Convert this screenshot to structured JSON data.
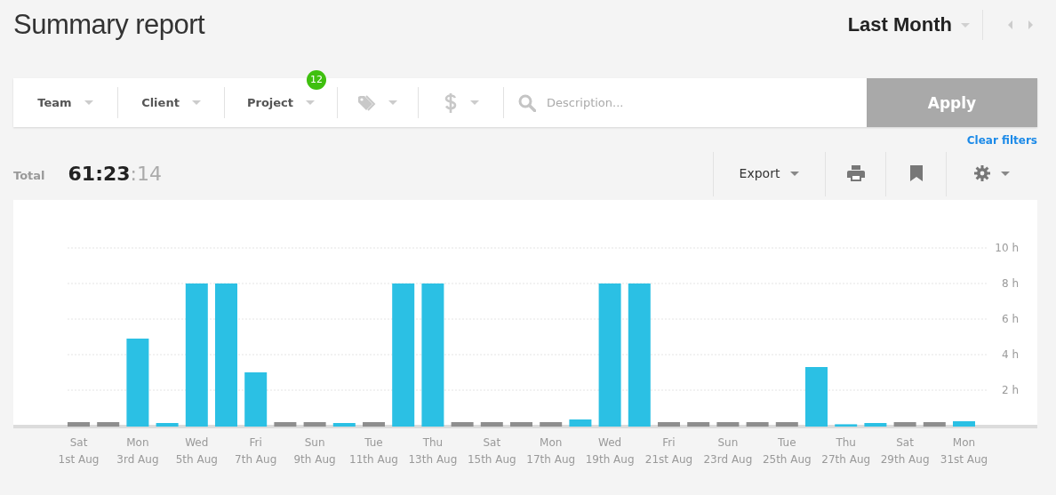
{
  "title": "Summary report",
  "period": {
    "label": "Last Month"
  },
  "filters": [
    {
      "kind": "text",
      "label": "Team"
    },
    {
      "kind": "text",
      "label": "Client"
    },
    {
      "kind": "text",
      "label": "Project",
      "badge": "12"
    },
    {
      "kind": "tag"
    },
    {
      "kind": "billable"
    }
  ],
  "search": {
    "placeholder": "Description..."
  },
  "apply_button": {
    "label": "Apply",
    "disabled": true
  },
  "clear_filters": "Clear filters",
  "total": {
    "label": "Total",
    "main": "61:23",
    "seconds": ":14"
  },
  "toolbar": {
    "export": "Export"
  },
  "chart": {
    "chart_data": {
      "type": "bar",
      "categories": [
        "Sat\n1st Aug",
        null,
        "Mon\n3rd Aug",
        null,
        "Wed\n5th Aug",
        null,
        "Fri\n7th Aug",
        null,
        "Sun\n9th Aug",
        null,
        "Tue\n11th Aug",
        null,
        "Thu\n13th Aug",
        null,
        "Sat\n15th Aug",
        null,
        "Mon\n17th Aug",
        null,
        "Wed\n19th Aug",
        null,
        "Fri\n21st Aug",
        null,
        "Sun\n23rd Aug",
        null,
        "Tue\n25th Aug",
        null,
        "Thu\n27th Aug",
        null,
        "Sat\n29th Aug",
        null,
        "Mon\n31st Aug"
      ],
      "series": [
        {
          "color": "#2bc0e4",
          "values": [
            0,
            0,
            4.9,
            0.15,
            8,
            8,
            3,
            0,
            0,
            0.15,
            0,
            8,
            8,
            0,
            0,
            0,
            0,
            0.35,
            8,
            8,
            0,
            0,
            0,
            0,
            0,
            3.3,
            0.08,
            0.15,
            0,
            0,
            0.25
          ]
        }
      ],
      "ylim": [
        0,
        10
      ],
      "grid": true,
      "yticks": [
        {
          "value": 2,
          "label": "2 h"
        },
        {
          "value": 4,
          "label": "4 h"
        },
        {
          "value": 6,
          "label": "6 h"
        },
        {
          "value": 8,
          "label": "8 h"
        },
        {
          "value": 10,
          "label": "10 h"
        }
      ]
    }
  }
}
